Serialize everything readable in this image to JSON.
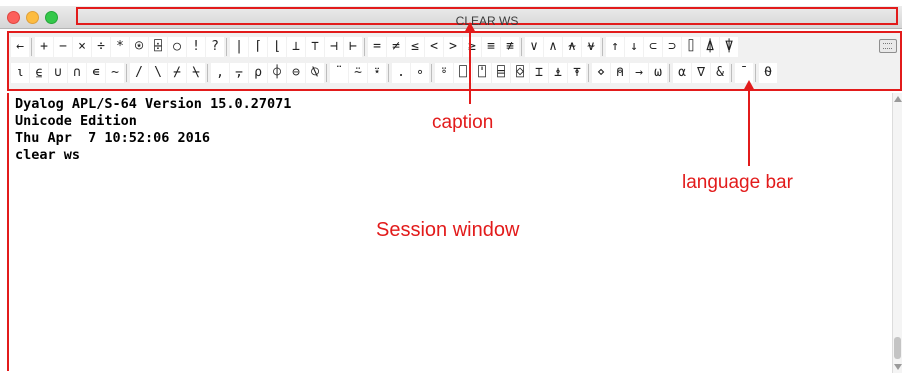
{
  "window": {
    "title": "CLEAR WS"
  },
  "language_bar": {
    "row1": [
      "←",
      "+",
      "−",
      "×",
      "÷",
      "*",
      "⍟",
      "⌹",
      "○",
      "!",
      "?",
      "|",
      "⌈",
      "⌊",
      "⊥",
      "⊤",
      "⊣",
      "⊢",
      "=",
      "≠",
      "≤",
      "<",
      ">",
      "≥",
      "≡",
      "≢",
      "∨",
      "∧",
      "⍲",
      "⍱",
      "↑",
      "↓",
      "⊂",
      "⊃",
      "⌷",
      "⍋",
      "⍒"
    ],
    "row2": [
      "⍳",
      "⍷",
      "∪",
      "∩",
      "∊",
      "~",
      "/",
      "\\",
      "⌿",
      "⍀",
      ",",
      "⍪",
      "⍴",
      "⌽",
      "⊖",
      "⍉",
      "¨",
      "⍨",
      "⍣",
      ".",
      "∘",
      "⍤",
      "⎕",
      "⍞",
      "⌸",
      "⌺",
      "⌶",
      "⍎",
      "⍕",
      "⋄",
      "⍝",
      "→",
      "⍵",
      "⍺",
      "∇",
      "&",
      "¯",
      "⍬"
    ]
  },
  "session": {
    "lines": [
      "Dyalog APL/S-64 Version 15.0.27071",
      "Unicode Edition",
      "Thu Apr  7 10:52:06 2016",
      "clear ws"
    ]
  },
  "annotations": {
    "caption": "caption",
    "language_bar": "language bar",
    "session_window": "Session window"
  },
  "colors": {
    "annotation": "#e21b1b",
    "titlebar": "#dcdcdc"
  }
}
